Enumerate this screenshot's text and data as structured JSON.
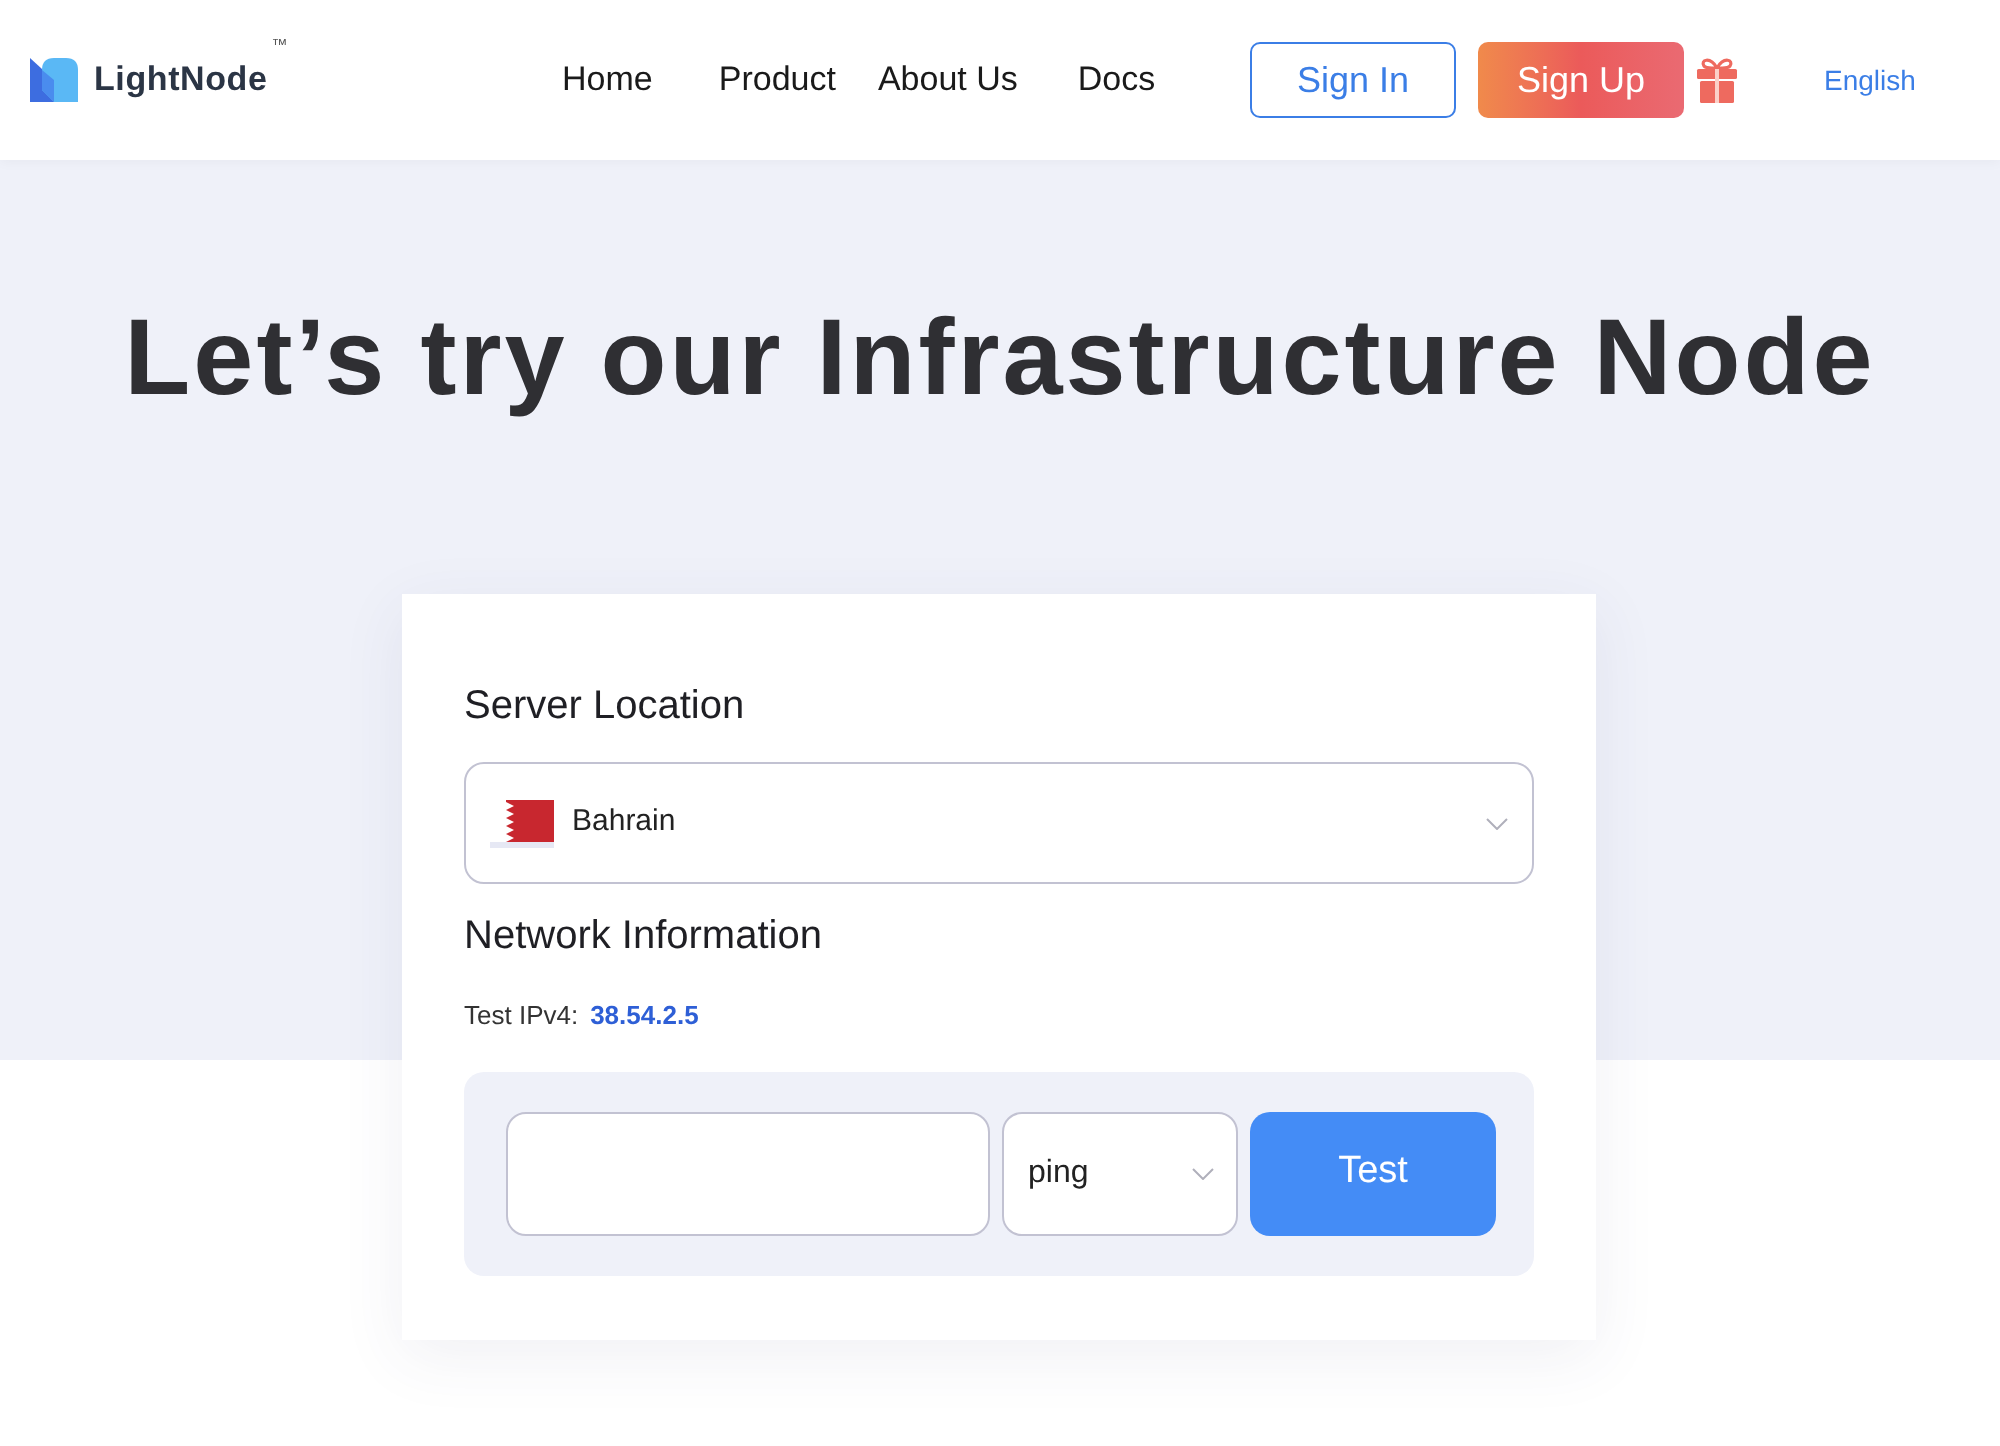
{
  "header": {
    "logo": {
      "name": "LightNode",
      "mark": "™"
    },
    "nav": [
      "Home",
      "Product",
      "About Us",
      "Docs"
    ],
    "sign_in": "Sign In",
    "sign_up": "Sign Up",
    "language": "English"
  },
  "hero": {
    "title": "Let’s try our Infrastructure Node"
  },
  "card": {
    "server_location": {
      "label": "Server Location",
      "value": "Bahrain"
    },
    "network": {
      "title": "Network Information",
      "ipv4_label": "Test IPv4:",
      "ipv4": "38.54.2.5"
    },
    "test": {
      "method": "ping",
      "button": "Test"
    }
  }
}
